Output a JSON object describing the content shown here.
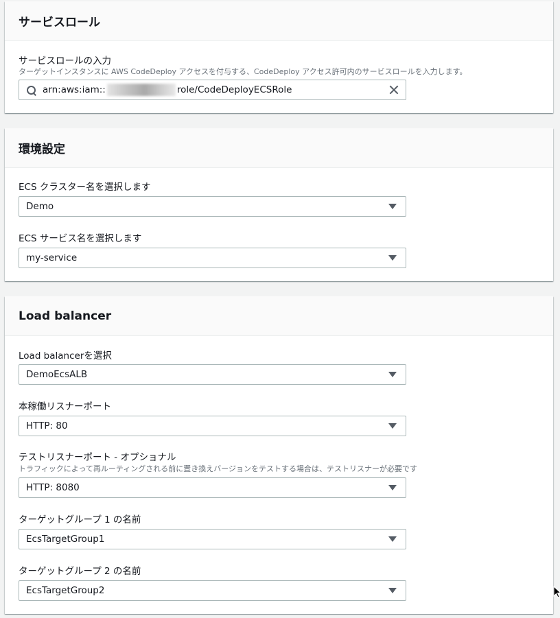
{
  "service_role": {
    "title": "サービスロール",
    "input_label": "サービスロールの入力",
    "input_desc": "ターゲットインスタンスに AWS CodeDeploy アクセスを付与する、CodeDeploy アクセス許可内のサービスロールを入力します。",
    "input_value_prefix": "arn:aws:iam::",
    "input_value_suffix": "role/CodeDeployECSRole",
    "icons": {
      "search": "search-icon",
      "clear": "close-icon"
    }
  },
  "environment": {
    "title": "環境設定",
    "cluster_label": "ECS クラスター名を選択します",
    "cluster_value": "Demo",
    "service_label": "ECS サービス名を選択します",
    "service_value": "my-service"
  },
  "load_balancer": {
    "title": "Load balancer",
    "lb_label": "Load balancerを選択",
    "lb_value": "DemoEcsALB",
    "prod_listener_label": "本稼働リスナーポート",
    "prod_listener_value": "HTTP: 80",
    "test_listener_label": "テストリスナーポート - オプショナル",
    "test_listener_desc": "トラフィックによって再ルーティングされる前に置き換えバージョンをテストする場合は、テストリスナーが必要です",
    "test_listener_value": "HTTP: 8080",
    "tg1_label": "ターゲットグループ 1 の名前",
    "tg1_value": "EcsTargetGroup1",
    "tg2_label": "ターゲットグループ 2 の名前",
    "tg2_value": "EcsTargetGroup2"
  }
}
